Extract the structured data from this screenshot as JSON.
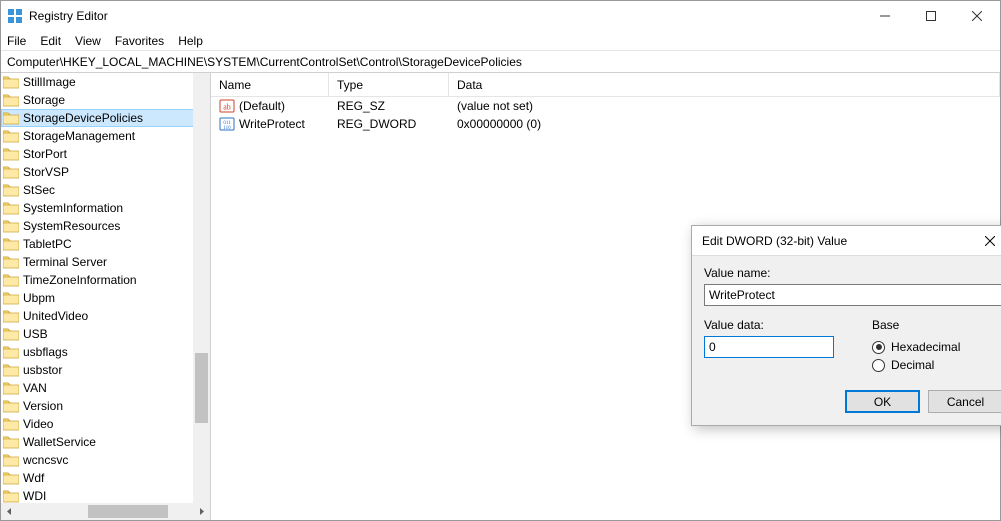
{
  "window": {
    "title": "Registry Editor"
  },
  "menubar": [
    "File",
    "Edit",
    "View",
    "Favorites",
    "Help"
  ],
  "address": "Computer\\HKEY_LOCAL_MACHINE\\SYSTEM\\CurrentControlSet\\Control\\StorageDevicePolicies",
  "tree": {
    "items": [
      {
        "name": "StillImage",
        "selected": false
      },
      {
        "name": "Storage",
        "selected": false
      },
      {
        "name": "StorageDevicePolicies",
        "selected": true
      },
      {
        "name": "StorageManagement",
        "selected": false
      },
      {
        "name": "StorPort",
        "selected": false
      },
      {
        "name": "StorVSP",
        "selected": false
      },
      {
        "name": "StSec",
        "selected": false
      },
      {
        "name": "SystemInformation",
        "selected": false
      },
      {
        "name": "SystemResources",
        "selected": false
      },
      {
        "name": "TabletPC",
        "selected": false
      },
      {
        "name": "Terminal Server",
        "selected": false
      },
      {
        "name": "TimeZoneInformation",
        "selected": false
      },
      {
        "name": "Ubpm",
        "selected": false
      },
      {
        "name": "UnitedVideo",
        "selected": false
      },
      {
        "name": "USB",
        "selected": false
      },
      {
        "name": "usbflags",
        "selected": false
      },
      {
        "name": "usbstor",
        "selected": false
      },
      {
        "name": "VAN",
        "selected": false
      },
      {
        "name": "Version",
        "selected": false
      },
      {
        "name": "Video",
        "selected": false
      },
      {
        "name": "WalletService",
        "selected": false
      },
      {
        "name": "wcncsvc",
        "selected": false
      },
      {
        "name": "Wdf",
        "selected": false
      },
      {
        "name": "WDI",
        "selected": false
      }
    ]
  },
  "list": {
    "columns": {
      "name": "Name",
      "type": "Type",
      "data": "Data"
    },
    "rows": [
      {
        "icon": "string",
        "name": "(Default)",
        "type": "REG_SZ",
        "data": "(value not set)"
      },
      {
        "icon": "binary",
        "name": "WriteProtect",
        "type": "REG_DWORD",
        "data": "0x00000000 (0)"
      }
    ]
  },
  "dialog": {
    "title": "Edit DWORD (32-bit) Value",
    "value_name_label": "Value name:",
    "value_name": "WriteProtect",
    "value_data_label": "Value data:",
    "value_data": "0",
    "base_label": "Base",
    "radio_hex": "Hexadecimal",
    "radio_dec": "Decimal",
    "base_selected": "hex",
    "ok": "OK",
    "cancel": "Cancel"
  }
}
